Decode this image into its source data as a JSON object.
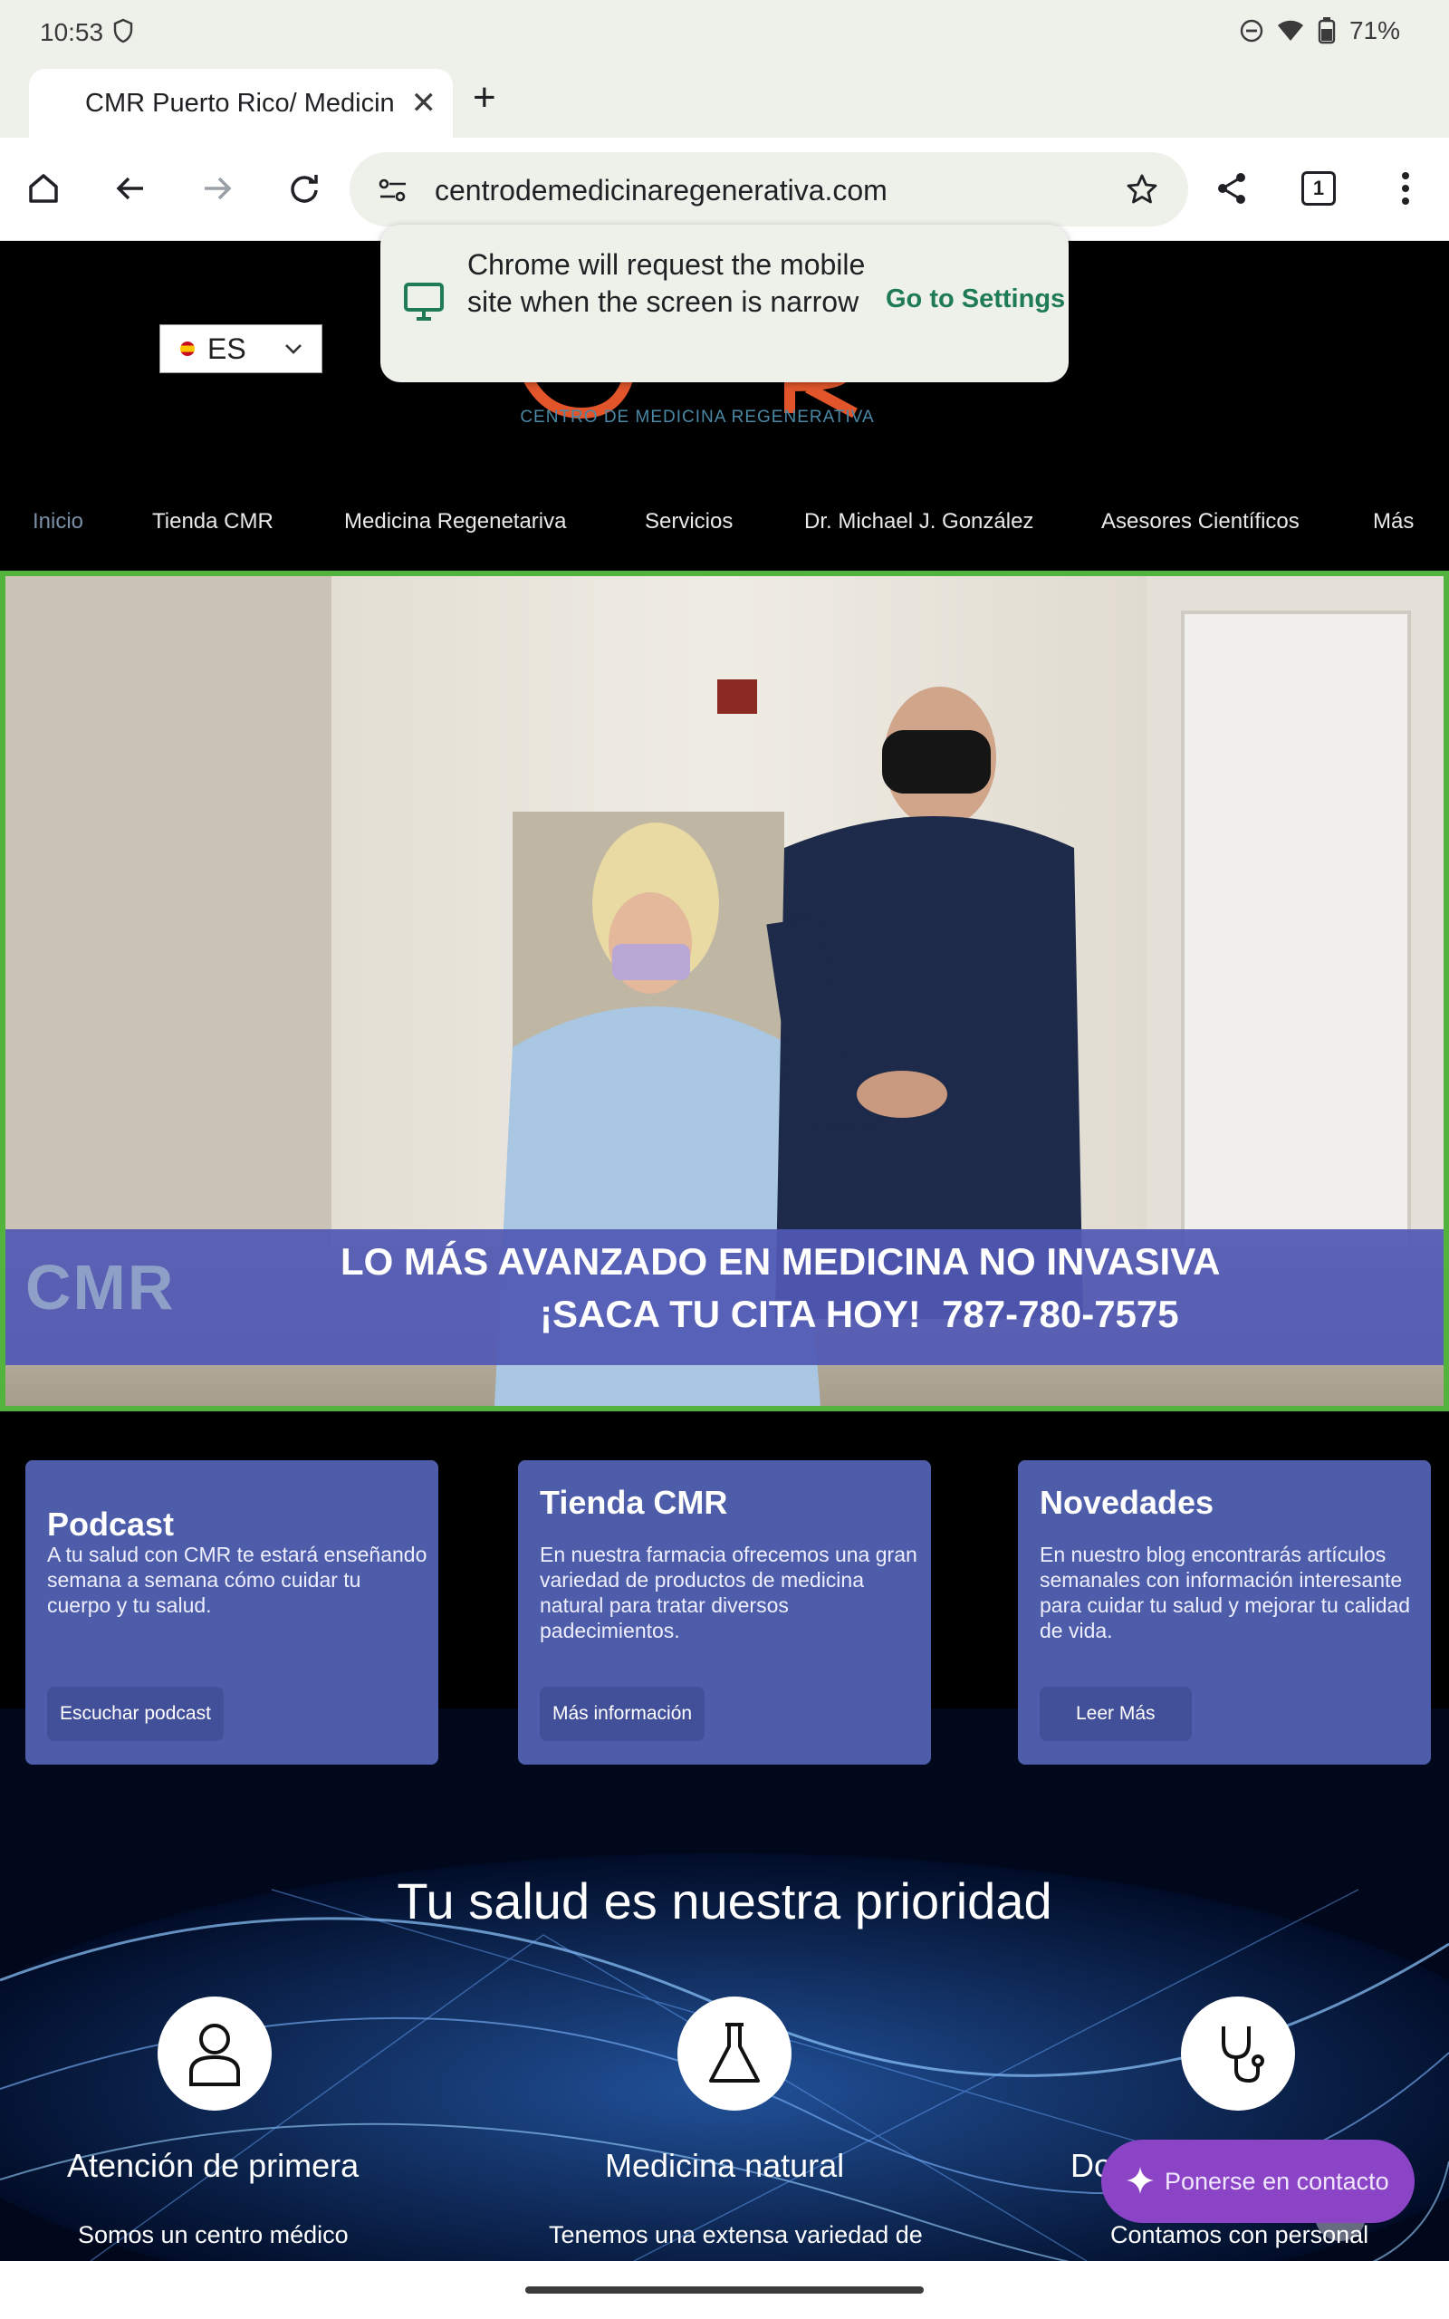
{
  "status_bar": {
    "time": "10:53",
    "battery": "71%"
  },
  "tab": {
    "title": "CMR Puerto Rico/ Medicina",
    "close_icon": "close-icon"
  },
  "toolbar": {
    "url": "centrodemedicinaregenerativa.com",
    "tab_count": "1"
  },
  "popup": {
    "message": "Chrome will request the mobile site when the screen is narrow",
    "action": "Go to Settings"
  },
  "site": {
    "language": {
      "label": "ES"
    },
    "logo_subtitle": "CENTRO DE MEDICINA REGENERATIVA",
    "nav": [
      "Inicio",
      "Tienda CMR",
      "Medicina Regenetariva",
      "Servicios",
      "Dr. Michael J. González",
      "Asesores Científicos",
      "Más"
    ],
    "video": {
      "logo": "CMR",
      "banner_line1": "LO MÁS AVANZADO EN MEDICINA NO INVASIVA",
      "banner_line2": "¡SACA TU CITA HOY!  787-780-7575"
    },
    "cards": [
      {
        "title": "Podcast",
        "body": "A tu salud con CMR te estará enseñando semana a semana cómo cuidar tu cuerpo y tu salud.",
        "button": "Escuchar podcast"
      },
      {
        "title": "Tienda CMR",
        "body": "En nuestra farmacia ofrecemos una gran variedad de productos de medicina natural para tratar diversos padecimientos.",
        "button": "Más información"
      },
      {
        "title": "Novedades",
        "body": "En nuestro blog encontrarás artículos semanales con información interesante para cuidar tu salud y mejorar tu calidad de vida.",
        "button": "Leer Más"
      }
    ],
    "priority_heading": "Tu salud es nuestra prioridad",
    "features": [
      {
        "title": "Atención de primera",
        "text": "Somos un centro médico",
        "icon": "user-icon"
      },
      {
        "title": "Medicina natural",
        "text": "Tenemos una extensa variedad de",
        "icon": "flask-icon"
      },
      {
        "title": "Do",
        "text": "Contamos con personal",
        "icon": "stethoscope-icon"
      }
    ],
    "contact_button": "Ponerse en contacto"
  }
}
